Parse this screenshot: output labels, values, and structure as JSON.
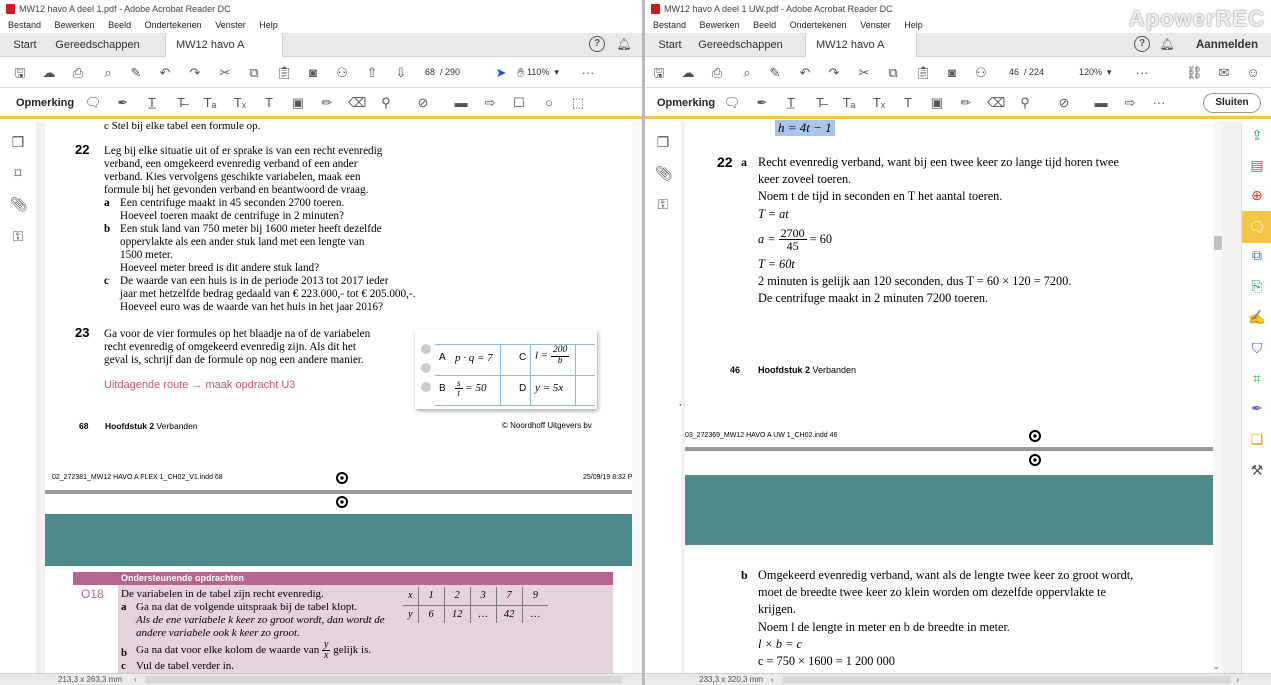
{
  "left": {
    "title": "MW12 havo A deel 1.pdf - Adobe Acrobat Reader DC",
    "menu": [
      "Bestand",
      "Bewerken",
      "Beeld",
      "Ondertekenen",
      "Venster",
      "Help"
    ],
    "tabs": {
      "start": "Start",
      "tools": "Gereedschappen",
      "doc": "MW12 havo A deel..."
    },
    "page_current": "68",
    "page_total": "/ 290",
    "zoom": "110%",
    "comment_label": "Opmerking",
    "status": "213,3 x 263,3 mm",
    "book": {
      "c_top": "c   Stel bij elke tabel een formule op.",
      "q22_num": "22",
      "q22_lines": [
        "Leg bij elke situatie uit of er sprake is van een recht evenredig",
        "verband, een omgekeerd evenredig verband of een ander",
        "verband. Kies vervolgens geschikte variabelen, maak een",
        "formule bij het gevonden verband en beantwoord de vraag."
      ],
      "a_label": "a",
      "a_lines": [
        "Een centrifuge maakt in 45 seconden 2700 toeren.",
        "Hoeveel toeren maakt de centrifuge in 2 minuten?"
      ],
      "b_label": "b",
      "b_lines": [
        "Een stuk land van 750 meter bij 1600 meter heeft dezelfde",
        "oppervlakte als een ander stuk land met een lengte van",
        "1500 meter.",
        "Hoeveel meter breed is dit andere stuk land?"
      ],
      "c_label": "c",
      "c_lines": [
        "De waarde van een huis is in de periode 2013 tot 2017 ieder",
        "jaar met hetzelfde bedrag gedaald van € 223.000,- tot € 205.000,-.",
        "Hoeveel euro was de waarde van het huis in het jaar 2016?"
      ],
      "q23_num": "23",
      "q23_lines": [
        "Ga voor de vier formules op het blaadje na of de variabelen",
        "recht evenredig of omgekeerd evenredig zijn. Als dit het",
        "geval is, schrijf dan de formule op nog een andere manier."
      ],
      "route": "Uitdagende route → maak opdracht U3",
      "card": {
        "A": "A",
        "A_f": "p · q = 7",
        "C": "C",
        "C_lhs": "l =",
        "C_num": "200",
        "C_den": "b",
        "B": "B",
        "B_num": "s",
        "B_den": "t",
        "B_rhs": "= 50",
        "D": "D",
        "D_f": "y = 5x"
      },
      "footer_page": "68",
      "footer_chapter": "Hoofdstuk 2",
      "footer_chapter_rest": " Verbanden",
      "footer_copy": "© Noordhoff Uitgevers bv",
      "indd": "02_272381_MW12 HAVO A FLEX 1_CH02_V1.indd   68",
      "indd_date": "25/09/19   8:32 PM",
      "support_header": "Ondersteunende opdrachten",
      "o18": "O18",
      "o18_line": "De variabelen in de tabel zijn recht evenredig.",
      "o18_a": "a",
      "o18_a_line": "Ga na dat de volgende uitspraak bij de tabel klopt.",
      "o18_a_it": [
        "Als de ene variabele k keer zo groot wordt, dan wordt de",
        "andere variabele ook k keer zo groot."
      ],
      "o18_b": "b",
      "o18_b_line1": "Ga na dat voor elke kolom de waarde van",
      "o18_b_num": "y",
      "o18_b_den": "x",
      "o18_b_line2": "gelijk is.",
      "o18_c": "c",
      "o18_c_line": "Vul de tabel verder in.",
      "tbl_x": [
        "x",
        "1",
        "2",
        "3",
        "7",
        "9"
      ],
      "tbl_y": [
        "y",
        "6",
        "12",
        "…",
        "42",
        "…"
      ]
    }
  },
  "right": {
    "title": "MW12 havo A deel 1 UW.pdf - Adobe Acrobat Reader DC",
    "menu": [
      "Bestand",
      "Bewerken",
      "Beeld",
      "Ondertekenen",
      "Venster",
      "Help"
    ],
    "tabs": {
      "start": "Start",
      "tools": "Gereedschappen",
      "doc": "MW12 havo A deel..."
    },
    "signin": "Aanmelden",
    "page_current": "46",
    "page_total": "/ 224",
    "zoom": "120%",
    "comment_label": "Opmerking",
    "close": "Sluiten",
    "status": "233,3 x 320,3 mm",
    "watermark": "ApowerREC",
    "book": {
      "h_formula": "h = 4t − 1",
      "q22": "22",
      "q22_a": "a",
      "l1": "Recht evenredig verband, want bij een twee keer zo lange tijd horen twee",
      "l2": "keer zoveel toeren.",
      "l3": "Noem t de tijd in seconden en T het aantal toeren.",
      "l4": "T = at",
      "l5_lhs": "a =",
      "l5_num": "2700",
      "l5_den": "45",
      "l5_rhs": "= 60",
      "l6": "T = 60t",
      "l7": "2 minuten is gelijk aan 120 seconden, dus T = 60 × 120 = 7200.",
      "l8": "De centrifuge maakt in 2 minuten 7200 toeren.",
      "footer_page": "46",
      "footer_chapter": "Hoofdstuk 2",
      "footer_chapter_rest": " Verbanden",
      "indd": "03_272369_MW12 HAVO A UW 1_CH02.indd   46",
      "b_label": "b",
      "b1": "Omgekeerd evenredig verband, want als de lengte twee keer zo groot wordt,",
      "b2": "moet de breedte twee keer zo klein worden om dezelfde oppervlakte te",
      "b3": "krijgen.",
      "b4": "Noem l de lengte in meter en b de breedte in meter.",
      "b5": "l × b = c",
      "b6": "c = 750 × 1600 = 1 200 000"
    }
  },
  "colors": {
    "accent": "#f4c542",
    "route": "#c0567a",
    "teal": "#4f8a8d",
    "support": "#b5658f",
    "highlight": "#a9c6ea"
  }
}
